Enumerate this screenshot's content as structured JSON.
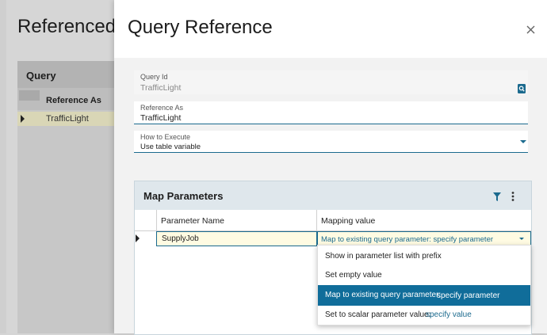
{
  "background": {
    "title": "Referenced",
    "panel_title": "Query",
    "column_label": "Reference As",
    "row_label": "TrafficLight"
  },
  "modal": {
    "title": "Query Reference",
    "close_icon": "close-icon"
  },
  "form": {
    "query_id": {
      "label": "Query Id",
      "value": "TrafficLight",
      "icon": "lookup-icon"
    },
    "reference_as": {
      "label": "Reference As",
      "value": "TrafficLight"
    },
    "how_to_execute": {
      "label": "How to Execute",
      "value": "Use table variable",
      "icon": "chevron-down-icon"
    }
  },
  "map_parameters": {
    "title": "Map Parameters",
    "icons": [
      "filter-icon",
      "more-vertical-icon"
    ],
    "columns": [
      "Parameter Name",
      "Mapping value"
    ],
    "rows": [
      {
        "parameter": "SupplyJob",
        "mapping_label": "Map to existing query parameter:",
        "mapping_link": "specify parameter"
      }
    ]
  },
  "menu": {
    "items": [
      {
        "label": "Show in parameter list with prefix",
        "link": ""
      },
      {
        "label": "Set empty value",
        "link": ""
      },
      {
        "label": "Map to existing query parameter:",
        "link": "specify parameter",
        "selected": true
      },
      {
        "label": "Set to scalar parameter value:",
        "link": "specify value"
      }
    ]
  },
  "colors": {
    "accent": "#1b6a8e",
    "menu_selected": "#106d9a",
    "row_highlight": "#fffbe2"
  }
}
